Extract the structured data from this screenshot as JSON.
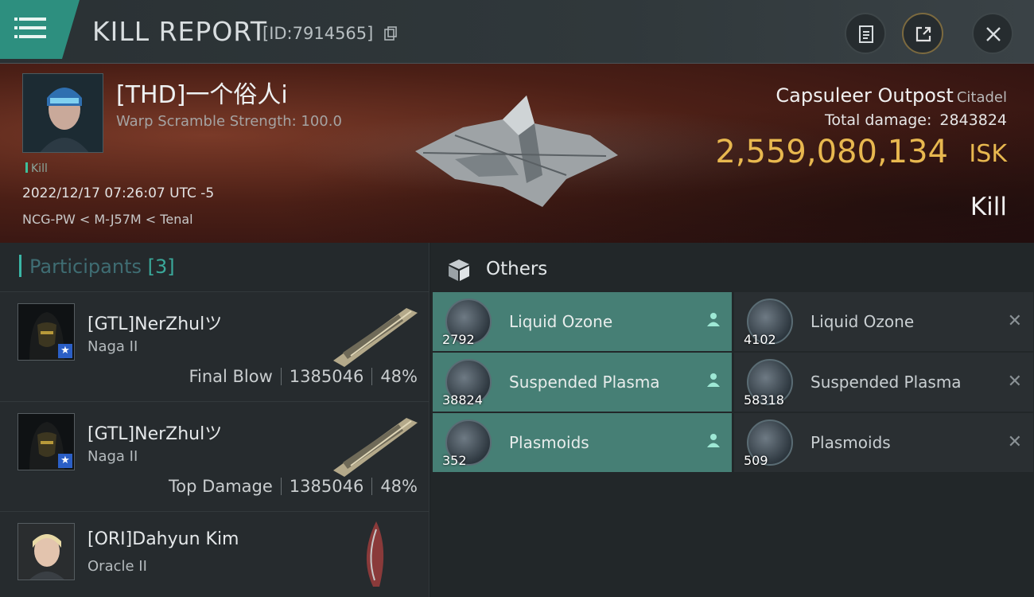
{
  "header": {
    "title": "KILL REPORT",
    "id": "[ID:7914565]"
  },
  "victim": {
    "name": "[THD]一个俗人i",
    "sub": "Warp Scramble Strength: 100.0",
    "tag": "Kill",
    "time": "2022/12/17 07:26:07 UTC -5",
    "location": "NCG-PW < M-J57M < Tenal"
  },
  "target": {
    "ship": "Capsuleer Outpost",
    "class": "Citadel",
    "total_damage_label": "Total damage:",
    "total_damage": "2843824",
    "isk_value": "2,559,080,134",
    "isk_unit": "ISK",
    "result": "Kill"
  },
  "participants": {
    "title": "Participants",
    "count": "[3]",
    "items": [
      {
        "name": "[GTL]NerZhulツ",
        "ship": "Naga II",
        "role": "Final Blow",
        "damage": "1385046",
        "percent": "48%"
      },
      {
        "name": "[GTL]NerZhulツ",
        "ship": "Naga II",
        "role": "Top Damage",
        "damage": "1385046",
        "percent": "48%"
      },
      {
        "name": "[ORI]Dahyun Kim",
        "ship": "Oracle II"
      }
    ]
  },
  "others": {
    "title": "Others",
    "dropped": [
      {
        "qty": "2792",
        "name": "Liquid Ozone"
      },
      {
        "qty": "38824",
        "name": "Suspended Plasma"
      },
      {
        "qty": "352",
        "name": "Plasmoids"
      }
    ],
    "destroyed": [
      {
        "qty": "4102",
        "name": "Liquid Ozone"
      },
      {
        "qty": "58318",
        "name": "Suspended Plasma"
      },
      {
        "qty": "509",
        "name": "Plasmoids"
      }
    ]
  },
  "colors": {
    "accent": "#2d8f7f",
    "isk": "#e8b84f",
    "dropped_bg": "#467f75"
  }
}
